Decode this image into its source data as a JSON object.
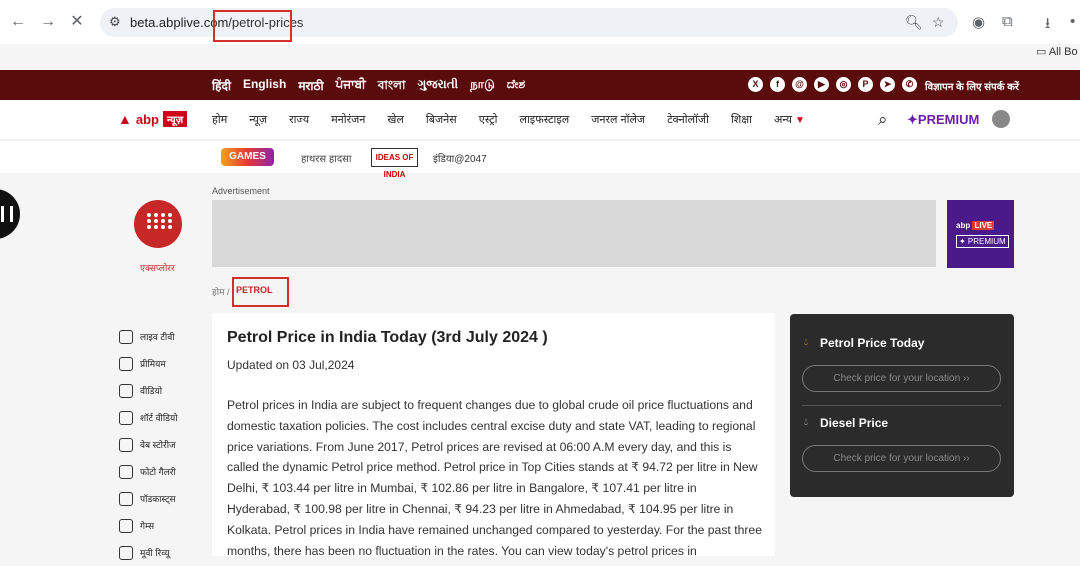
{
  "browser": {
    "url_host": "beta.abplive.com",
    "url_path": "/petrol-prices",
    "bookmarks_label": "All Bo"
  },
  "languages": [
    "हिंदी",
    "English",
    "मराठी",
    "ਪੰਜਾਬੀ",
    "বাংলা",
    "ગુજરાતી",
    "நாடு",
    "ದೇಶ"
  ],
  "advertise_contact": "विज्ञापन के लिए संपर्क करें",
  "nav": {
    "logo_abp": "abp",
    "logo_news": "न्यूज़",
    "items": [
      "होम",
      "न्यूज़",
      "राज्य",
      "मनोरंजन",
      "खेल",
      "बिजनेस",
      "एस्ट्रो",
      "लाइफस्टाइल",
      "जनरल नॉलेज",
      "टेक्नोलॉजी",
      "शिक्षा"
    ],
    "more": "अन्य",
    "premium": "✦PREMIUM"
  },
  "trending": {
    "games": "GAMES",
    "hathras": "हाथरस हादसा",
    "ideas": "IDEAS OF INDIA",
    "india2047": "इंडिया@2047"
  },
  "explore_label": "एक्सप्लोरर",
  "side_menu": [
    "लाइव टीवी",
    "प्रीमियम",
    "वीडियो",
    "शॉर्ट वीडियो",
    "वेब स्टोरीज",
    "फोटो गैलरी",
    "पॉडकास्ट्स",
    "गेम्स",
    "मूवी रिव्यू"
  ],
  "ad": {
    "label": "Advertisement",
    "promo_brand": "abp",
    "promo_live": "LIVE",
    "promo_premium": "✦ PREMIUM"
  },
  "breadcrumb": {
    "home": "होम /",
    "current": "PETROL"
  },
  "article": {
    "title": "Petrol Price in India Today (3rd July 2024 )",
    "updated": "Updated on 03 Jul,2024",
    "body": "Petrol prices in India are subject to frequent changes due to global crude oil price fluctuations and domestic taxation policies. The cost includes central excise duty and state VAT, leading to regional price variations. From June 2017, Petrol prices are revised at 06:00 A.M every day, and this is called the dynamic Petrol price method. Petrol price in Top Cities stands at ₹ 94.72 per litre in New Delhi, ₹ 103.44 per litre in Mumbai, ₹ 102.86 per litre in Bangalore, ₹ 107.41 per litre in Hyderabad, ₹ 100.98 per litre in Chennai, ₹ 94.23 per litre in Ahmedabad, ₹ 104.95 per litre in Kolkata. Petrol prices in India have remained unchanged compared to yesterday. For the past three months, there has been no fluctuation in the rates. You can view today's petrol prices in"
  },
  "price_card": {
    "petrol_title": "Petrol Price Today",
    "petrol_button": "Check price for your location ››",
    "diesel_title": "Diesel Price",
    "diesel_button": "Check price for your location ››"
  }
}
